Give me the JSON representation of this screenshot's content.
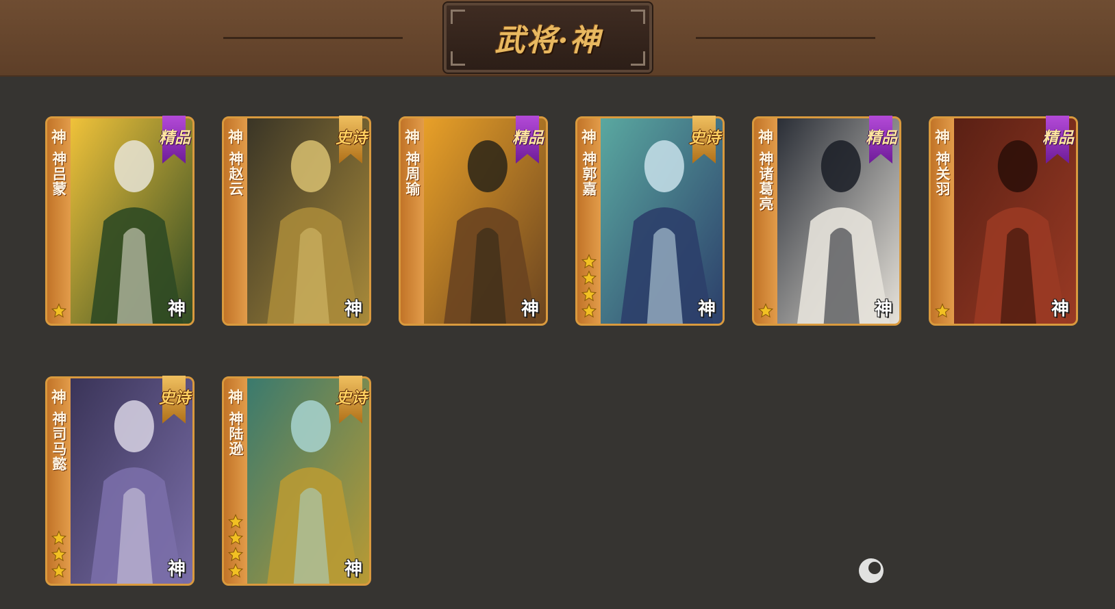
{
  "header": {
    "title": "武将·神"
  },
  "colors": {
    "background": "#363431",
    "header": "#6f4d32",
    "card_border": "#d99a3e",
    "jingpin_ribbon": "#9a34c4",
    "shishi_ribbon": "#d89a38",
    "star": "#f2c023"
  },
  "cards": [
    {
      "tag": "神",
      "name": "神吕蒙",
      "badge": "精品",
      "badge_type": "jing",
      "stars": 1,
      "seal": "神",
      "palette": [
        "#f0c23a",
        "#2f4a24",
        "#e8e4d6"
      ]
    },
    {
      "tag": "神",
      "name": "神赵云",
      "badge": "史诗",
      "badge_type": "shi",
      "stars": 0,
      "seal": "神",
      "palette": [
        "#3a3526",
        "#a88a3a",
        "#d8c070"
      ]
    },
    {
      "tag": "神",
      "name": "神周瑜",
      "badge": "精品",
      "badge_type": "jing",
      "stars": 0,
      "seal": "神",
      "palette": [
        "#e8a028",
        "#6a4420",
        "#2a2418"
      ]
    },
    {
      "tag": "神",
      "name": "神郭嘉",
      "badge": "史诗",
      "badge_type": "shi",
      "stars": 4,
      "seal": "神",
      "palette": [
        "#5aa8a0",
        "#2c3f6a",
        "#c8e0ea"
      ]
    },
    {
      "tag": "神",
      "name": "神诸葛亮",
      "badge": "精品",
      "badge_type": "jing",
      "stars": 1,
      "seal": "神",
      "palette": [
        "#2a2e36",
        "#e6e2da",
        "#1a1d26"
      ]
    },
    {
      "tag": "神",
      "name": "神关羽",
      "badge": "精品",
      "badge_type": "jing",
      "stars": 1,
      "seal": "神",
      "palette": [
        "#5a2014",
        "#9a3a24",
        "#2a0e08"
      ]
    },
    {
      "tag": "神",
      "name": "神司马懿",
      "badge": "史诗",
      "badge_type": "shi",
      "stars": 3,
      "seal": "神",
      "palette": [
        "#3a3458",
        "#7a6ea8",
        "#d8d4e4"
      ]
    },
    {
      "tag": "神",
      "name": "神陆逊",
      "badge": "史诗",
      "badge_type": "shi",
      "stars": 4,
      "seal": "神",
      "palette": [
        "#3a7a6e",
        "#b89a34",
        "#a8d4d0"
      ]
    }
  ]
}
